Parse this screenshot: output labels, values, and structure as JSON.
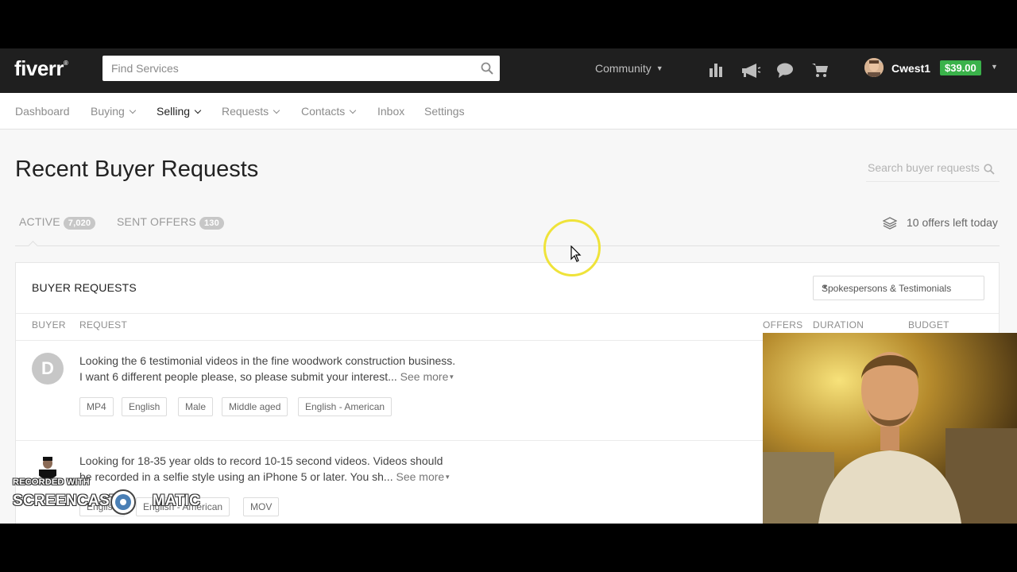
{
  "header": {
    "logo": "fiverr",
    "logo_mark": "®",
    "search_placeholder": "Find Services",
    "community_label": "Community",
    "icons": [
      "bar-chart-icon",
      "megaphone-icon",
      "chat-bubble-icon",
      "cart-icon"
    ],
    "username": "Cwest1",
    "balance": "$39.00"
  },
  "subnav": {
    "items": [
      {
        "label": "Dashboard",
        "dropdown": false,
        "active": false
      },
      {
        "label": "Buying",
        "dropdown": true,
        "active": false
      },
      {
        "label": "Selling",
        "dropdown": true,
        "active": true
      },
      {
        "label": "Requests",
        "dropdown": true,
        "active": false
      },
      {
        "label": "Contacts",
        "dropdown": true,
        "active": false
      },
      {
        "label": "Inbox",
        "dropdown": false,
        "active": false
      },
      {
        "label": "Settings",
        "dropdown": false,
        "active": false
      }
    ]
  },
  "page": {
    "title": "Recent Buyer Requests",
    "search_placeholder": "Search buyer requests",
    "tabs": [
      {
        "label": "ACTIVE",
        "count": "7,020"
      },
      {
        "label": "SENT OFFERS",
        "count": "130"
      }
    ],
    "offers_left": "10 offers left today"
  },
  "buyer_requests": {
    "title": "BUYER REQUESTS",
    "category": "Spokespersons & Testimonials",
    "columns": [
      "BUYER",
      "REQUEST",
      "OFFERS",
      "DURATION",
      "BUDGET"
    ],
    "rows": [
      {
        "buyer_initial": "D",
        "line1": "Looking the 6 testimonial videos in the fine woodwork construction business.",
        "line2": "I want 6 different people please, so please submit your interest...",
        "see_more": "See more",
        "tags": [
          "MP4",
          "English",
          "Male",
          "Middle aged",
          "English - American"
        ]
      },
      {
        "buyer_initial": "",
        "line1": "Looking for 18-35 year olds to record 10-15 second videos. Videos should",
        "line2": "be recorded in a selfie style using an iPhone 5 or later. You sh...",
        "see_more": "See more",
        "tags": [
          "English",
          "English - American",
          "MOV"
        ]
      }
    ]
  },
  "watermark": {
    "small": "RECORDED WITH",
    "big_left": "SCREENCAST",
    "big_right": "MATIC"
  },
  "colors": {
    "header_bg": "#1f1f1f",
    "balance_green": "#3ab24a",
    "cursor_ring": "#efe33a"
  }
}
